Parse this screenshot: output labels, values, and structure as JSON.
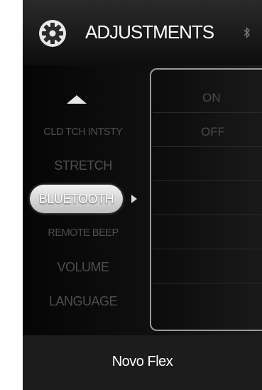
{
  "header": {
    "title": "ADJUSTMENTS",
    "settings_icon": "gear-icon",
    "status_icon": "bluetooth-icon"
  },
  "menu": {
    "items": [
      {
        "label": "CLD TCH INTSTY"
      },
      {
        "label": "STRETCH"
      },
      {
        "label": "BLUETOOTH",
        "selected": true
      },
      {
        "label": "REMOTE BEEP"
      },
      {
        "label": "VOLUME"
      },
      {
        "label": "LANGUAGE"
      }
    ]
  },
  "options": {
    "items": [
      {
        "label": "ON"
      },
      {
        "label": "OFF"
      }
    ]
  },
  "footer": {
    "text": "Novo Flex"
  },
  "colors": {
    "background": "#000000",
    "text_active": "#ffffff",
    "text_inactive": "#4e4e4e",
    "panel_border": "#9a9a9a"
  }
}
